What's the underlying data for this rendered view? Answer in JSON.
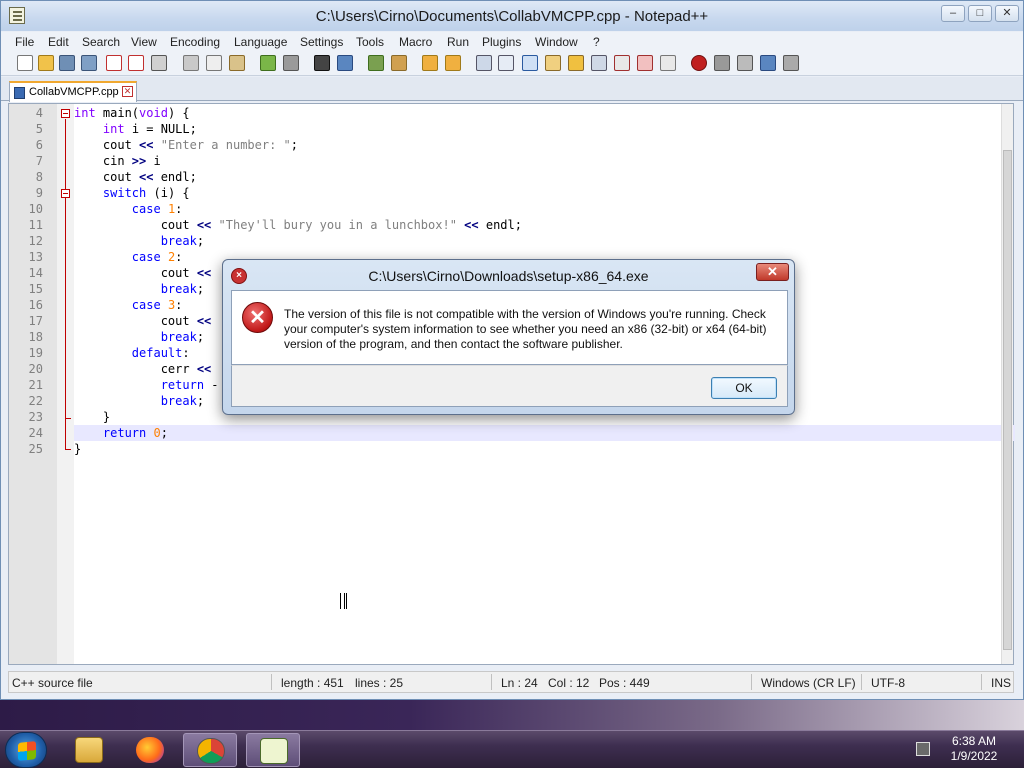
{
  "window": {
    "title": "C:\\Users\\Cirno\\Documents\\CollabVMCPP.cpp - Notepad++",
    "controls": {
      "minimize": "–",
      "maximize": "□",
      "close": "✕"
    }
  },
  "menu": {
    "items": [
      "File",
      "Edit",
      "Search",
      "View",
      "Encoding",
      "Language",
      "Settings",
      "Tools",
      "Macro",
      "Run",
      "Plugins",
      "Window",
      "?"
    ]
  },
  "tab": {
    "label": "CollabVMCPP.cpp",
    "close": "✕"
  },
  "editor": {
    "current_line": 24,
    "lines": [
      {
        "n": "4",
        "text": "int main(void) {"
      },
      {
        "n": "5",
        "text": "    int i = NULL;"
      },
      {
        "n": "6",
        "text": "    cout << \"Enter a number: \";"
      },
      {
        "n": "7",
        "text": "    cin >> i"
      },
      {
        "n": "8",
        "text": "    cout << endl;"
      },
      {
        "n": "9",
        "text": "    switch (i) {"
      },
      {
        "n": "10",
        "text": "        case 1:"
      },
      {
        "n": "11",
        "text": "            cout << \"They'll bury you in a lunchbox!\" << endl;"
      },
      {
        "n": "12",
        "text": "            break;"
      },
      {
        "n": "13",
        "text": "        case 2:"
      },
      {
        "n": "14",
        "text": "            cout << "
      },
      {
        "n": "15",
        "text": "            break;"
      },
      {
        "n": "16",
        "text": "        case 3:"
      },
      {
        "n": "17",
        "text": "            cout << "
      },
      {
        "n": "18",
        "text": "            break;"
      },
      {
        "n": "19",
        "text": "        default:"
      },
      {
        "n": "20",
        "text": "            cerr << "
      },
      {
        "n": "21",
        "text": "            return -"
      },
      {
        "n": "22",
        "text": "            break;"
      },
      {
        "n": "23",
        "text": "    }"
      },
      {
        "n": "24",
        "text": "    return 0;"
      },
      {
        "n": "25",
        "text": "}"
      }
    ]
  },
  "status": {
    "file_type": "C++ source file",
    "length": "length : 451",
    "lines": "lines : 25",
    "ln": "Ln : 24",
    "col": "Col : 12",
    "pos": "Pos : 449",
    "eol": "Windows (CR LF)",
    "encoding": "UTF-8",
    "mode": "INS"
  },
  "dialog": {
    "title": "C:\\Users\\Cirno\\Downloads\\setup-x86_64.exe",
    "message": "The version of this file is not compatible with the version of Windows you're running. Check your computer's system information to see whether you need an x86 (32-bit) or x64 (64-bit) version of the program, and then contact the software publisher.",
    "ok_label": "OK",
    "close": "✕",
    "icon": "error-icon"
  },
  "taskbar": {
    "items": [
      "start-button",
      "explorer-icon",
      "firefox-icon",
      "chrome-icon",
      "notepadpp-icon"
    ],
    "time": "6:38 AM",
    "date": "1/9/2022"
  },
  "colors": {
    "keyword": "#0000ff",
    "type": "#8000ff",
    "string": "#808080",
    "number": "#ff8000",
    "current_line": "#e8e8ff"
  }
}
